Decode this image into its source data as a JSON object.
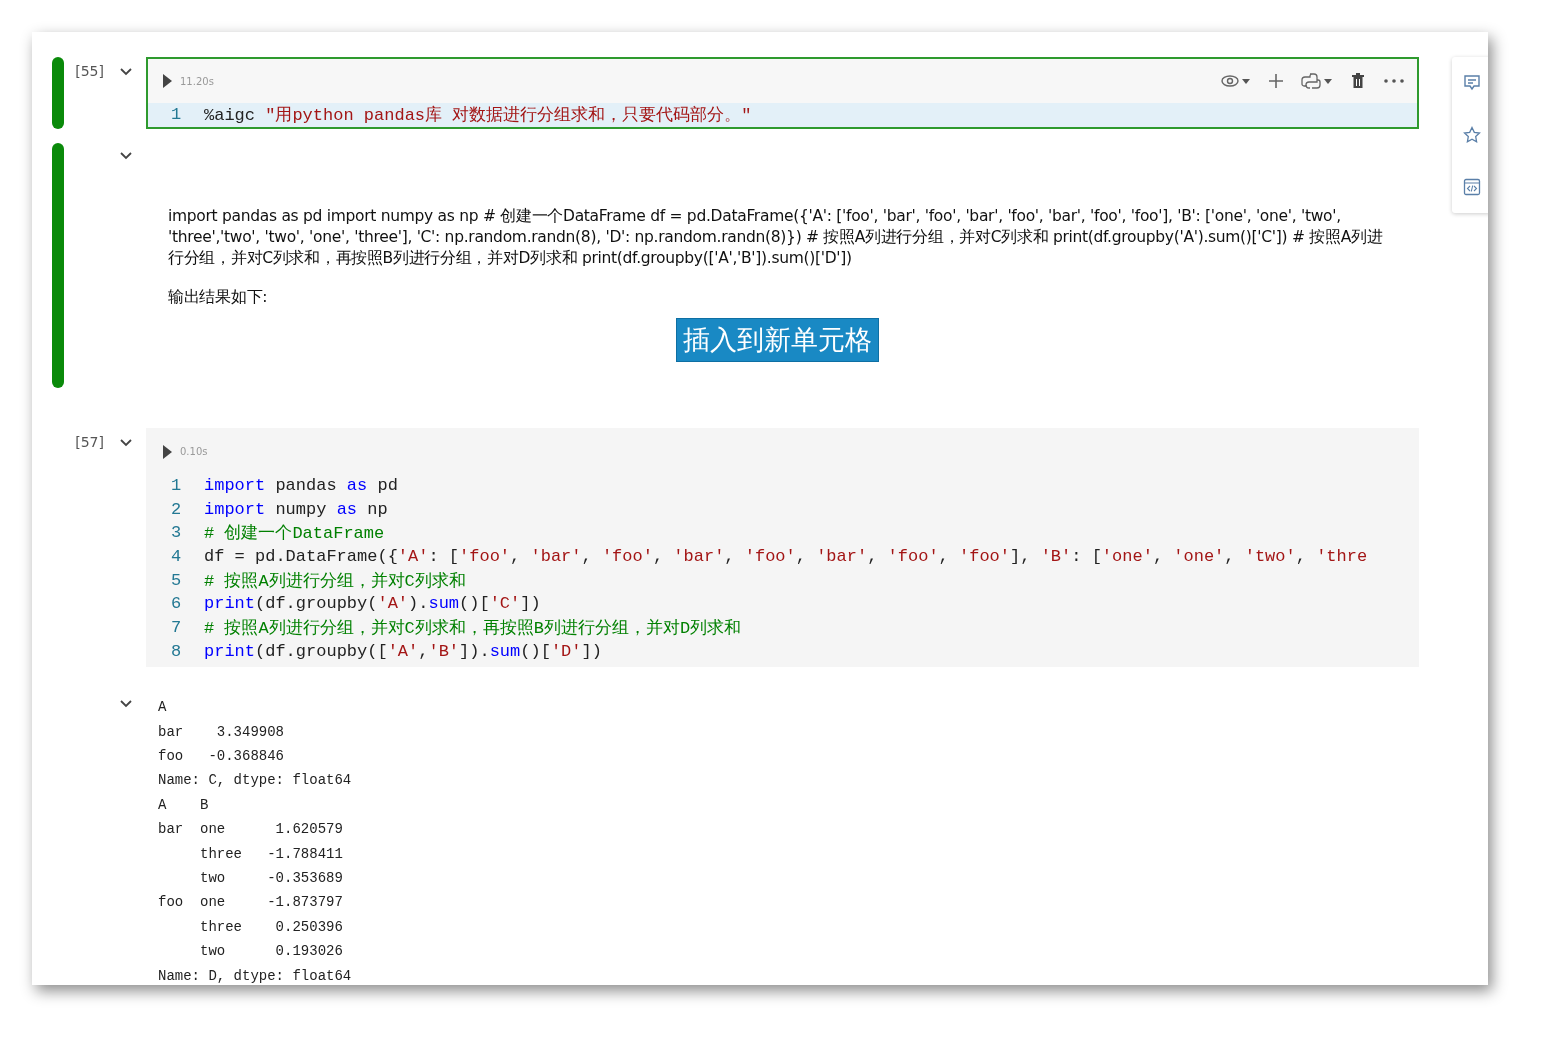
{
  "cells": [
    {
      "kind": "code",
      "selected": true,
      "expanded": true,
      "exec_count": "[55]",
      "duration": "11.20s",
      "lines": [
        {
          "number": "1",
          "highlighted": true,
          "tokens": [
            {
              "kind": "plain",
              "text": "%aigc "
            },
            {
              "kind": "str",
              "text": "\"用python pandas库 对数据进行分组求和，只要代码部分。\""
            }
          ]
        }
      ]
    },
    {
      "kind": "markdown",
      "selected": true,
      "expanded": true,
      "paragraphs": [
        "import pandas as pd import numpy as np # 创建一个DataFrame df = pd.DataFrame({'A': ['foo', 'bar', 'foo', 'bar', 'foo', 'bar', 'foo', 'foo'], 'B': ['one', 'one', 'two', 'three','two', 'two', 'one', 'three'], 'C': np.random.randn(8), 'D': np.random.randn(8)}) # 按照A列进行分组，并对C列求和 print(df.groupby('A').sum()['C']) # 按照A列进行分组，并对C列求和，再按照B列进行分组，并对D列求和 print(df.groupby(['A','B']).sum()['D'])",
        "输出结果如下:"
      ],
      "button": "插入到新单元格"
    },
    {
      "kind": "code",
      "selected": false,
      "expanded": true,
      "exec_count": "[57]",
      "duration": "0.10s",
      "lines": [
        {
          "number": "1",
          "tokens": [
            {
              "kind": "kw",
              "text": "import"
            },
            {
              "kind": "plain",
              "text": " pandas "
            },
            {
              "kind": "kw",
              "text": "as"
            },
            {
              "kind": "plain",
              "text": " pd"
            }
          ]
        },
        {
          "number": "2",
          "tokens": [
            {
              "kind": "kw",
              "text": "import"
            },
            {
              "kind": "plain",
              "text": " numpy "
            },
            {
              "kind": "kw",
              "text": "as"
            },
            {
              "kind": "plain",
              "text": " np"
            }
          ]
        },
        {
          "number": "3",
          "tokens": [
            {
              "kind": "cmt",
              "text": "# 创建一个DataFrame"
            }
          ]
        },
        {
          "number": "4",
          "tokens": [
            {
              "kind": "plain",
              "text": "df = pd.DataFrame({"
            },
            {
              "kind": "str",
              "text": "'A'"
            },
            {
              "kind": "plain",
              "text": ": ["
            },
            {
              "kind": "str",
              "text": "'foo'"
            },
            {
              "kind": "plain",
              "text": ", "
            },
            {
              "kind": "str",
              "text": "'bar'"
            },
            {
              "kind": "plain",
              "text": ", "
            },
            {
              "kind": "str",
              "text": "'foo'"
            },
            {
              "kind": "plain",
              "text": ", "
            },
            {
              "kind": "str",
              "text": "'bar'"
            },
            {
              "kind": "plain",
              "text": ", "
            },
            {
              "kind": "str",
              "text": "'foo'"
            },
            {
              "kind": "plain",
              "text": ", "
            },
            {
              "kind": "str",
              "text": "'bar'"
            },
            {
              "kind": "plain",
              "text": ", "
            },
            {
              "kind": "str",
              "text": "'foo'"
            },
            {
              "kind": "plain",
              "text": ", "
            },
            {
              "kind": "str",
              "text": "'foo'"
            },
            {
              "kind": "plain",
              "text": "], "
            },
            {
              "kind": "str",
              "text": "'B'"
            },
            {
              "kind": "plain",
              "text": ": ["
            },
            {
              "kind": "str",
              "text": "'one'"
            },
            {
              "kind": "plain",
              "text": ", "
            },
            {
              "kind": "str",
              "text": "'one'"
            },
            {
              "kind": "plain",
              "text": ", "
            },
            {
              "kind": "str",
              "text": "'two'"
            },
            {
              "kind": "plain",
              "text": ", "
            },
            {
              "kind": "str",
              "text": "'thre"
            }
          ]
        },
        {
          "number": "5",
          "tokens": [
            {
              "kind": "cmt",
              "text": "# 按照A列进行分组，并对C列求和"
            }
          ]
        },
        {
          "number": "6",
          "tokens": [
            {
              "kind": "fn",
              "text": "print"
            },
            {
              "kind": "plain",
              "text": "(df.groupby("
            },
            {
              "kind": "str",
              "text": "'A'"
            },
            {
              "kind": "plain",
              "text": ")."
            },
            {
              "kind": "fn",
              "text": "sum"
            },
            {
              "kind": "plain",
              "text": "()["
            },
            {
              "kind": "str",
              "text": "'C'"
            },
            {
              "kind": "plain",
              "text": "])"
            }
          ]
        },
        {
          "number": "7",
          "tokens": [
            {
              "kind": "cmt",
              "text": "# 按照A列进行分组，并对C列求和，再按照B列进行分组，并对D列求和"
            }
          ]
        },
        {
          "number": "8",
          "tokens": [
            {
              "kind": "fn",
              "text": "print"
            },
            {
              "kind": "plain",
              "text": "(df.groupby(["
            },
            {
              "kind": "str",
              "text": "'A'"
            },
            {
              "kind": "plain",
              "text": ","
            },
            {
              "kind": "str",
              "text": "'B'"
            },
            {
              "kind": "plain",
              "text": "])."
            },
            {
              "kind": "fn",
              "text": "sum"
            },
            {
              "kind": "plain",
              "text": "()["
            },
            {
              "kind": "str",
              "text": "'D'"
            },
            {
              "kind": "plain",
              "text": "])"
            }
          ]
        }
      ]
    },
    {
      "kind": "output",
      "expanded": true,
      "lines": [
        "A",
        "bar    3.349908",
        "foo   -0.368846",
        "Name: C, dtype: float64",
        "A    B",
        "bar  one      1.620579",
        "     three   -1.788411",
        "     two     -0.353689",
        "foo  one     -1.873797",
        "     three    0.250396",
        "     two      0.193026",
        "Name: D, dtype: float64"
      ]
    }
  ]
}
